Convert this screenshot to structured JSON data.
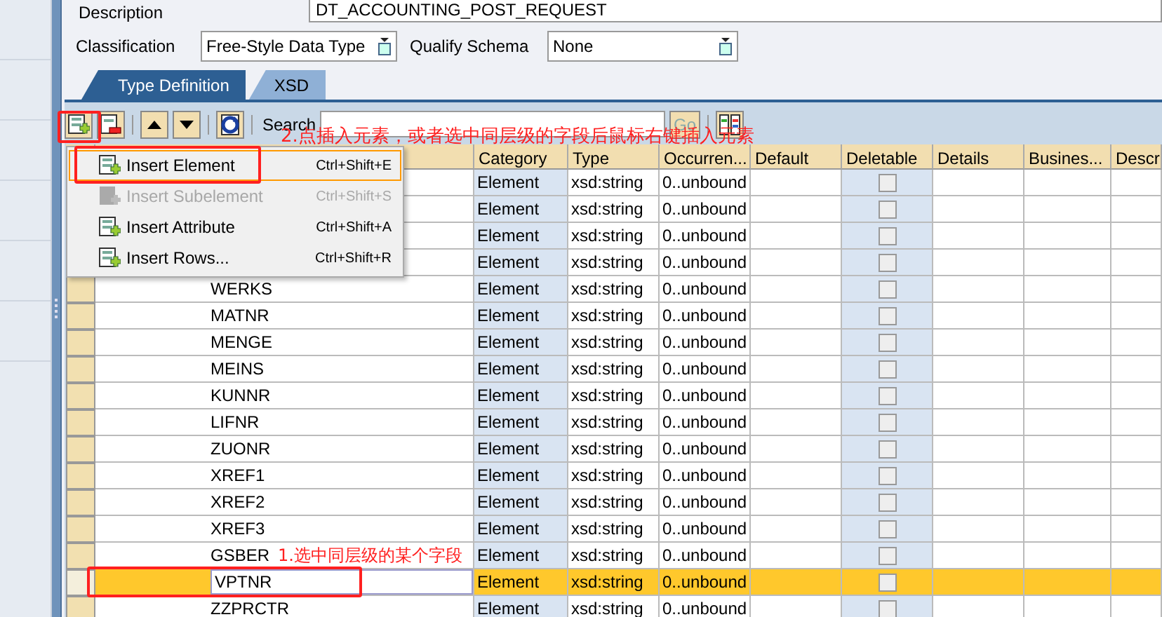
{
  "description": {
    "label": "Description",
    "value": "DT_ACCOUNTING_POST_REQUEST"
  },
  "classification": {
    "label": "Classification",
    "value": "Free-Style Data Type"
  },
  "qualify_schema": {
    "label": "Qualify Schema",
    "value": "None"
  },
  "tabs": [
    {
      "label": "Type Definition",
      "selected": true
    },
    {
      "label": "XSD",
      "selected": false
    }
  ],
  "toolbar": {
    "search_label": "Search",
    "go": "Go"
  },
  "table": {
    "columns": [
      "Category",
      "Type",
      "Occurren...",
      "Default",
      "Deletable",
      "Details",
      "Busines...",
      "Descr"
    ],
    "rows": [
      {
        "category": "Element",
        "type": "xsd:string",
        "occurrence": "0..unbound",
        "deletable": false,
        "selected": false
      },
      {
        "category": "Element",
        "type": "xsd:string",
        "occurrence": "0..unbound",
        "deletable": false,
        "selected": false
      },
      {
        "category": "Element",
        "type": "xsd:string",
        "occurrence": "0..unbound",
        "deletable": false,
        "selected": false
      },
      {
        "category": "Element",
        "type": "xsd:string",
        "occurrence": "0..unbound",
        "deletable": false,
        "selected": false
      },
      {
        "name": "WERKS",
        "category": "Element",
        "type": "xsd:string",
        "occurrence": "0..unbound",
        "deletable": false,
        "selected": false
      },
      {
        "name": "MATNR",
        "category": "Element",
        "type": "xsd:string",
        "occurrence": "0..unbound",
        "deletable": false,
        "selected": false
      },
      {
        "name": "MENGE",
        "category": "Element",
        "type": "xsd:string",
        "occurrence": "0..unbound",
        "deletable": false,
        "selected": false
      },
      {
        "name": "MEINS",
        "category": "Element",
        "type": "xsd:string",
        "occurrence": "0..unbound",
        "deletable": false,
        "selected": false
      },
      {
        "name": "KUNNR",
        "category": "Element",
        "type": "xsd:string",
        "occurrence": "0..unbound",
        "deletable": false,
        "selected": false
      },
      {
        "name": "LIFNR",
        "category": "Element",
        "type": "xsd:string",
        "occurrence": "0..unbound",
        "deletable": false,
        "selected": false
      },
      {
        "name": "ZUONR",
        "category": "Element",
        "type": "xsd:string",
        "occurrence": "0..unbound",
        "deletable": false,
        "selected": false
      },
      {
        "name": "XREF1",
        "category": "Element",
        "type": "xsd:string",
        "occurrence": "0..unbound",
        "deletable": false,
        "selected": false
      },
      {
        "name": "XREF2",
        "category": "Element",
        "type": "xsd:string",
        "occurrence": "0..unbound",
        "deletable": false,
        "selected": false
      },
      {
        "name": "XREF3",
        "category": "Element",
        "type": "xsd:string",
        "occurrence": "0..unbound",
        "deletable": false,
        "selected": false
      },
      {
        "name": "GSBER",
        "category": "Element",
        "type": "xsd:string",
        "occurrence": "0..unbound",
        "deletable": false,
        "selected": false
      },
      {
        "name": "VPTNR",
        "category": "Element",
        "type": "xsd:string",
        "occurrence": "0..unbound",
        "deletable": false,
        "selected": true
      },
      {
        "name": "ZZPRCTR",
        "category": "Element",
        "type": "xsd:string",
        "occurrence": "0..unbound",
        "deletable": false,
        "selected": false
      }
    ]
  },
  "menu": {
    "items": [
      {
        "label": "Insert Element",
        "shortcut": "Ctrl+Shift+E",
        "disabled": false,
        "selected": true
      },
      {
        "label": "Insert Subelement",
        "shortcut": "Ctrl+Shift+S",
        "disabled": true,
        "selected": false
      },
      {
        "label": "Insert Attribute",
        "shortcut": "Ctrl+Shift+A",
        "disabled": false,
        "selected": false
      },
      {
        "label": "Insert Rows...",
        "shortcut": "Ctrl+Shift+R",
        "disabled": false,
        "selected": false
      }
    ]
  },
  "annotations": [
    {
      "text": "2.点插入元素，或者选中同层级的字段后鼠标右键插入元素"
    },
    {
      "text": "1.选中同层级的某个字段"
    }
  ]
}
